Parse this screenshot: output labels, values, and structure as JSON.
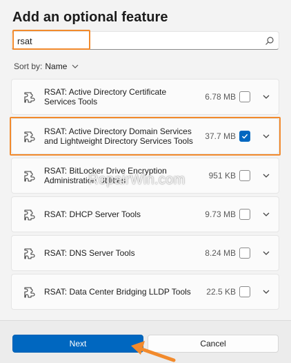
{
  "dialog": {
    "title": "Add an optional feature"
  },
  "search": {
    "value": "rsat",
    "icon": "search-icon"
  },
  "sort": {
    "label": "Sort by:",
    "value": "Name"
  },
  "features": [
    {
      "name": "RSAT: Active Directory Certificate Services Tools",
      "size": "6.78 MB",
      "checked": false
    },
    {
      "name": "RSAT: Active Directory Domain Services and Lightweight Directory Services Tools",
      "size": "37.7 MB",
      "checked": true
    },
    {
      "name": "RSAT: BitLocker Drive Encryption Administration Utilities",
      "size": "951 KB",
      "checked": false
    },
    {
      "name": "RSAT: DHCP Server Tools",
      "size": "9.73 MB",
      "checked": false
    },
    {
      "name": "RSAT: DNS Server Tools",
      "size": "8.24 MB",
      "checked": false
    },
    {
      "name": "RSAT: Data Center Bridging LLDP Tools",
      "size": "22.5 KB",
      "checked": false
    }
  ],
  "watermark": "RepairWin.com",
  "buttons": {
    "next": "Next",
    "cancel": "Cancel"
  },
  "colors": {
    "accent": "#0067c0",
    "highlight": "#f28a2c"
  }
}
